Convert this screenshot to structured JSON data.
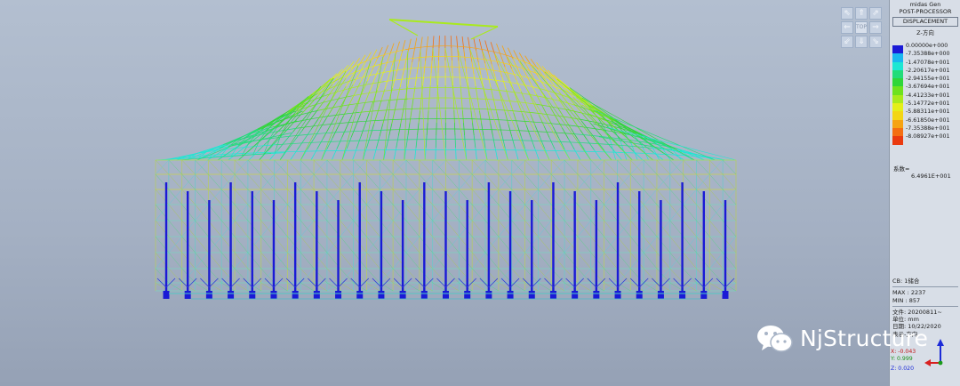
{
  "panel": {
    "app_title": "midas Gen",
    "mode": "POST-PROCESSOR",
    "result_type": "DISPLACEMENT",
    "component": "Z-方向",
    "legend": [
      {
        "value": "0.00000e+000",
        "color": "#1a1ad6"
      },
      {
        "value": "-7.35388e+000",
        "color": "#19b7ef"
      },
      {
        "value": "-1.47078e+001",
        "color": "#1ee7d3"
      },
      {
        "value": "-2.20617e+001",
        "color": "#22dc7a"
      },
      {
        "value": "-2.94155e+001",
        "color": "#2fd63a"
      },
      {
        "value": "-3.67694e+001",
        "color": "#6ee21f"
      },
      {
        "value": "-4.41233e+001",
        "color": "#a9ea1d"
      },
      {
        "value": "-5.14772e+001",
        "color": "#e4ef1a"
      },
      {
        "value": "-5.88311e+001",
        "color": "#f3d616"
      },
      {
        "value": "-6.61850e+001",
        "color": "#f6a313"
      },
      {
        "value": "-7.35388e+001",
        "color": "#f46e12"
      },
      {
        "value": "-8.08927e+001",
        "color": "#ea3a10"
      }
    ],
    "factor_label": "系数=",
    "factor_value": "6.4961E+001",
    "cb_label": "CB: 1储合",
    "max_label": "MAX : 2237",
    "min_label": "MIN : 857",
    "file_label": "文件: 20200811~",
    "unit_label": "单位: mm",
    "date_label": "日期: 10/22/2020",
    "view_dir_label": "表示-方向",
    "axis_x": "X: -0.043",
    "axis_y": "Y: 0.999",
    "axis_z": "Z: 0.020"
  },
  "view_cube": {
    "center_label": "TOP"
  },
  "watermark": {
    "text": "NjStructure"
  },
  "colors": {
    "background_top": "#b3bfd0",
    "background_bottom": "#95a1b5",
    "column": "#1a1ad6"
  }
}
